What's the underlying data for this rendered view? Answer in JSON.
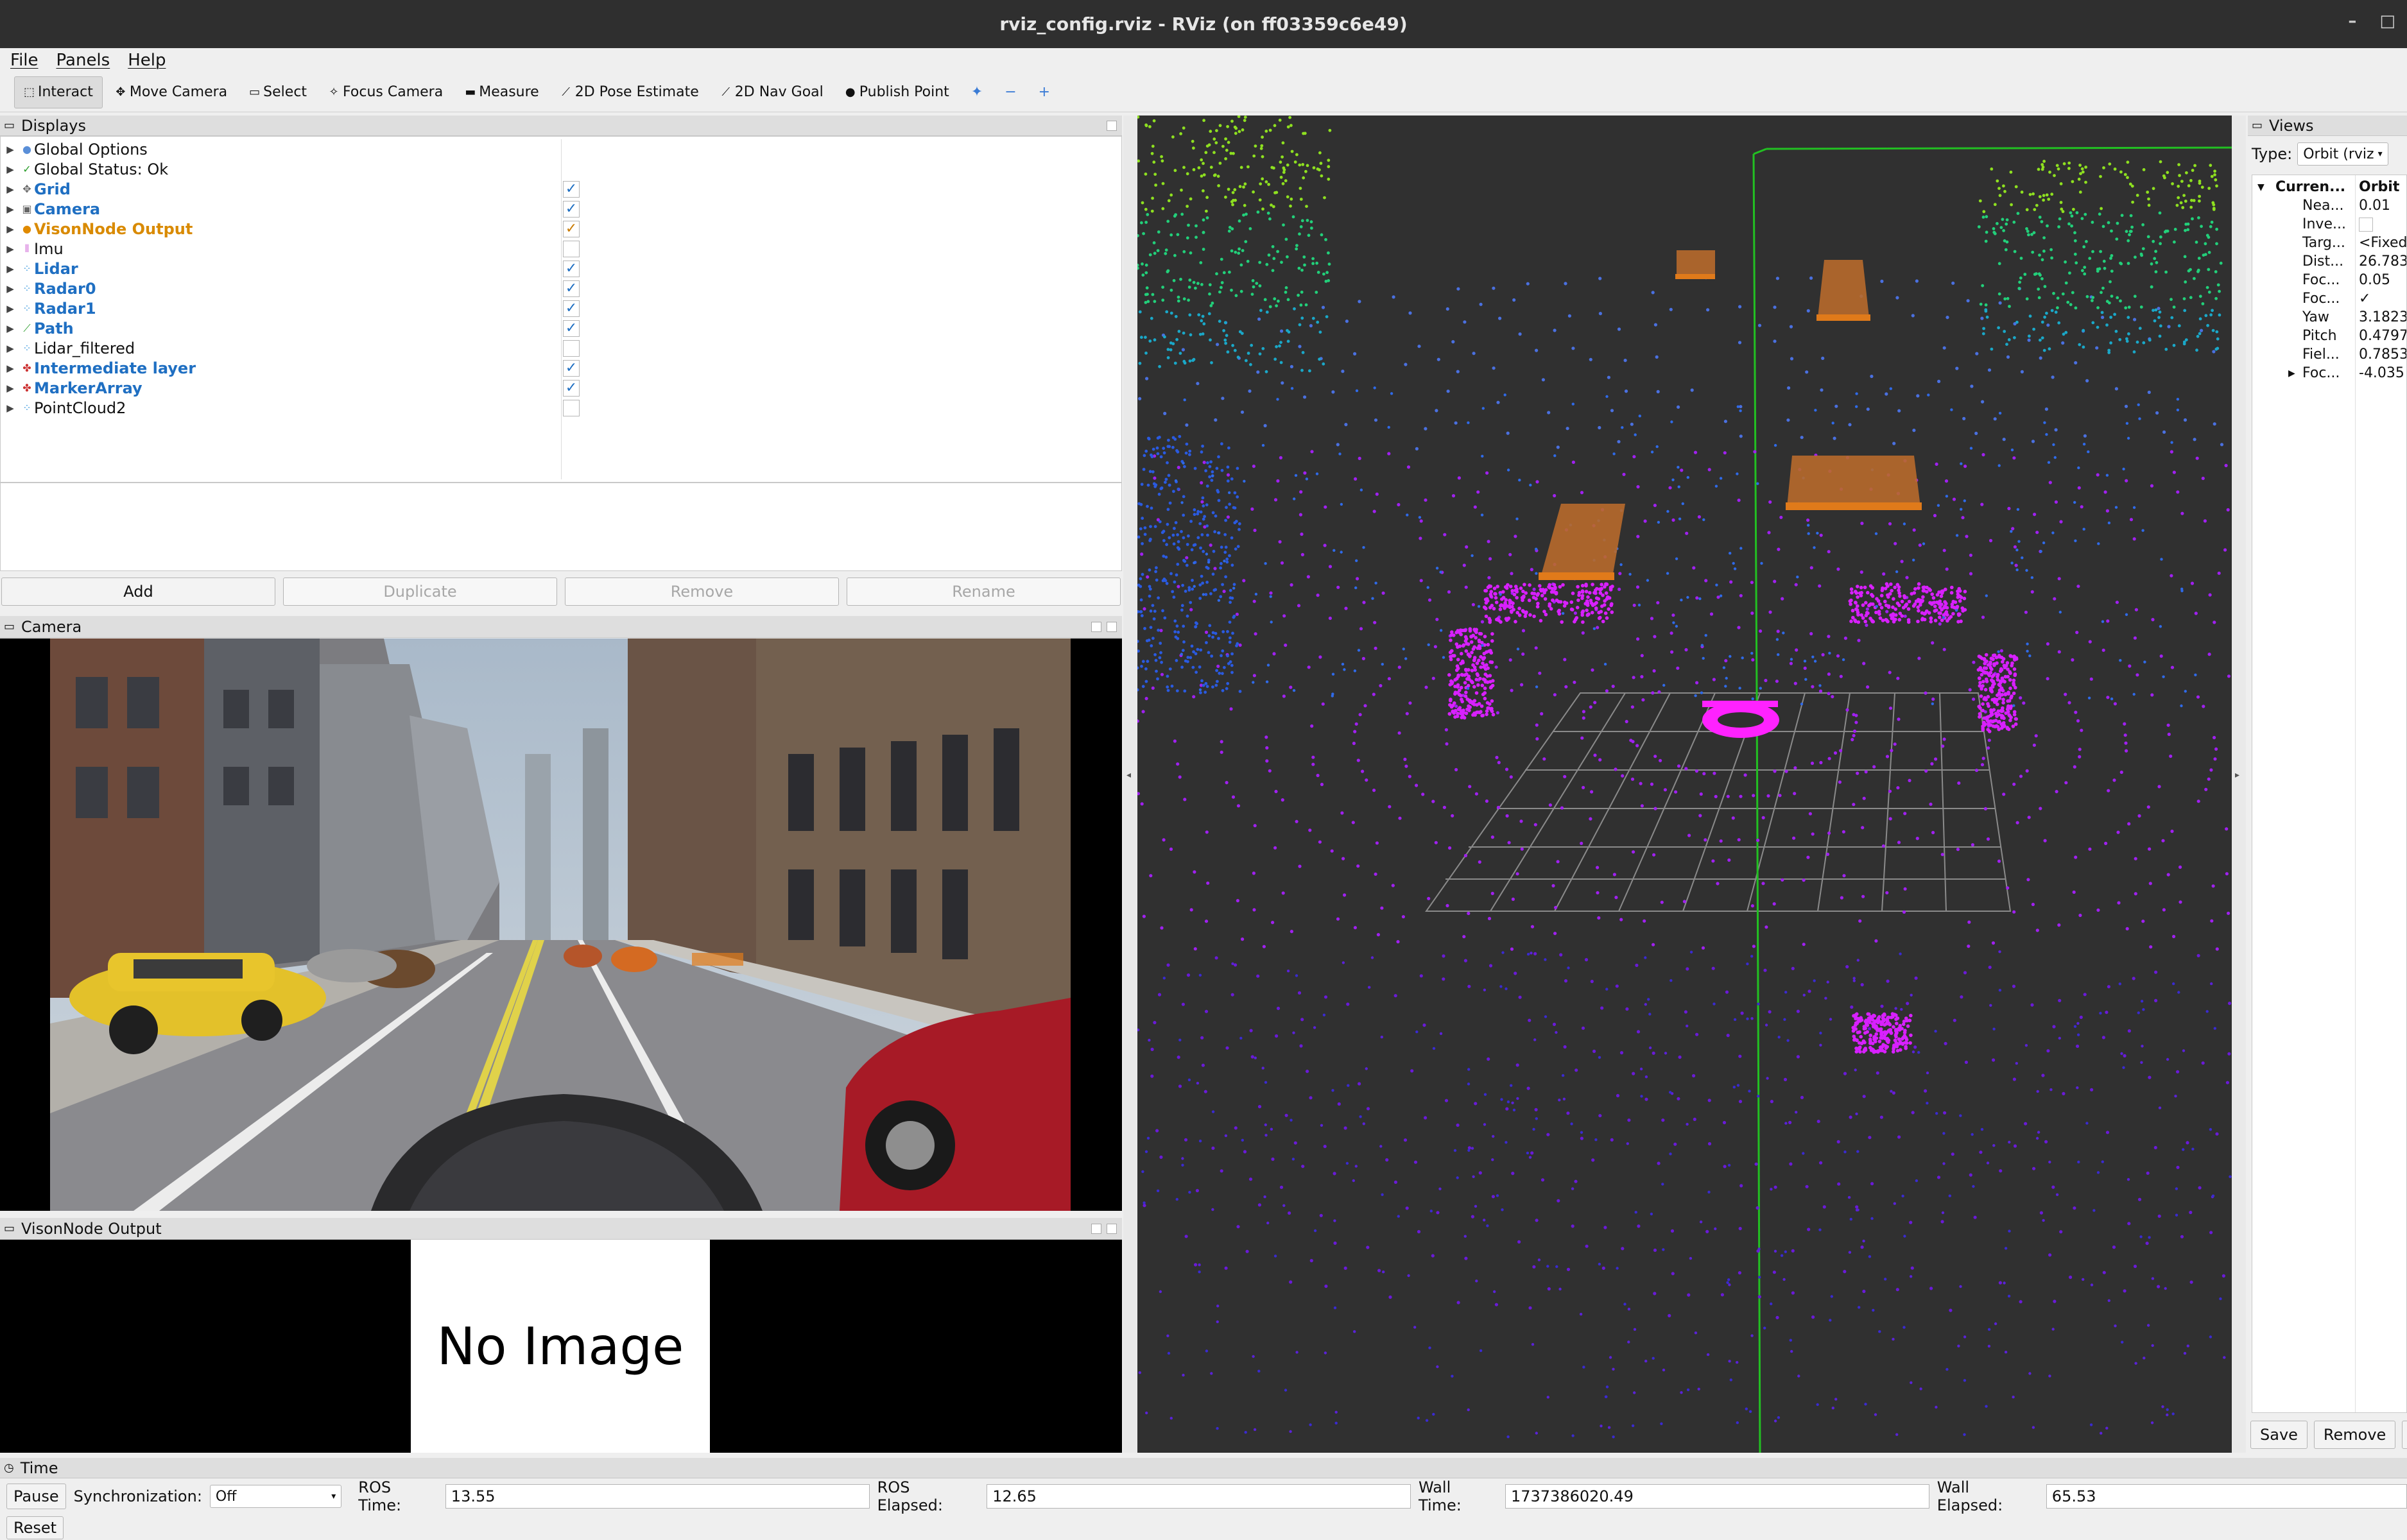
{
  "window": {
    "title": "rviz_config.rviz - RViz (on ff03359c6e49)",
    "controls": [
      "–",
      "□"
    ]
  },
  "menu": [
    "File",
    "Panels",
    "Help"
  ],
  "toolbar": {
    "tools": [
      {
        "label": "Interact",
        "icon": "interact-icon",
        "glyph": "⬚",
        "active": true
      },
      {
        "label": "Move Camera",
        "icon": "move-camera-icon",
        "glyph": "✥"
      },
      {
        "label": "Select",
        "icon": "select-icon",
        "glyph": "▭"
      },
      {
        "label": "Focus Camera",
        "icon": "focus-camera-icon",
        "glyph": "✧"
      },
      {
        "label": "Measure",
        "icon": "measure-icon",
        "glyph": "▬"
      },
      {
        "label": "2D Pose Estimate",
        "icon": "pose-estimate-icon",
        "glyph": "⟋"
      },
      {
        "label": "2D Nav Goal",
        "icon": "nav-goal-icon",
        "glyph": "⟋"
      },
      {
        "label": "Publish Point",
        "icon": "publish-point-icon",
        "glyph": "●"
      }
    ],
    "extra": [
      "✦",
      "−",
      "+"
    ]
  },
  "displays": {
    "title": "Displays",
    "items": [
      {
        "label": "Global Options",
        "icon": "●",
        "color": "#5a8fd8",
        "style": "normal",
        "checked": null
      },
      {
        "label": "Global Status: Ok",
        "icon": "✓",
        "color": "#2a9d2a",
        "style": "normal",
        "checked": null
      },
      {
        "label": "Grid",
        "icon": "✥",
        "color": "#666666",
        "style": "enabled",
        "checked": true
      },
      {
        "label": "Camera",
        "icon": "▣",
        "color": "#666666",
        "style": "enabled",
        "checked": true
      },
      {
        "label": "VisonNode Output",
        "icon": "●",
        "color": "#e08a00",
        "style": "warn",
        "checked": true
      },
      {
        "label": "Imu",
        "icon": "⦀",
        "color": "#d06ad8",
        "style": "normal",
        "checked": false
      },
      {
        "label": "Lidar",
        "icon": "⁘",
        "color": "#4aa0e0",
        "style": "enabled",
        "checked": true
      },
      {
        "label": "Radar0",
        "icon": "⁘",
        "color": "#4aa0e0",
        "style": "enabled",
        "checked": true
      },
      {
        "label": "Radar1",
        "icon": "⁘",
        "color": "#4aa0e0",
        "style": "enabled",
        "checked": true
      },
      {
        "label": "Path",
        "icon": "⟋",
        "color": "#2a9d2a",
        "style": "enabled",
        "checked": true
      },
      {
        "label": "Lidar_filtered",
        "icon": "⁘",
        "color": "#4aa0e0",
        "style": "normal",
        "checked": false
      },
      {
        "label": "Intermediate layer",
        "icon": "✤",
        "color": "#cc3333",
        "style": "enabled",
        "checked": true
      },
      {
        "label": "MarkerArray",
        "icon": "✤",
        "color": "#cc3333",
        "style": "enabled",
        "checked": true
      },
      {
        "label": "PointCloud2",
        "icon": "⁘",
        "color": "#4aa0e0",
        "style": "normal",
        "checked": false
      }
    ],
    "buttons": {
      "add": "Add",
      "duplicate": "Duplicate",
      "remove": "Remove",
      "rename": "Rename"
    }
  },
  "camera_panel": {
    "title": "Camera"
  },
  "vision_panel": {
    "title": "VisonNode Output",
    "placeholder": "No Image"
  },
  "views": {
    "title": "Views",
    "type_label": "Type:",
    "type_value": "Orbit (rviz",
    "header_key": "Curren...",
    "header_value": "Orbit",
    "rows": [
      {
        "k": "Nea...",
        "v": "0.01"
      },
      {
        "k": "Inve...",
        "v": ""
      },
      {
        "k": "Targ...",
        "v": "<Fixed"
      },
      {
        "k": "Dist...",
        "v": "26.783"
      },
      {
        "k": "Foc...",
        "v": "0.05"
      },
      {
        "k": "Foc...",
        "v": "✓"
      },
      {
        "k": "Yaw",
        "v": "3.1823"
      },
      {
        "k": "Pitch",
        "v": "0.4797"
      },
      {
        "k": "Fiel...",
        "v": "0.7853"
      },
      {
        "k": "Foc...",
        "v": "-4.035"
      }
    ],
    "buttons": {
      "save": "Save",
      "remove": "Remove",
      "rename": "R"
    }
  },
  "time": {
    "title": "Time",
    "pause": "Pause",
    "sync_label": "Synchronization:",
    "sync_value": "Off",
    "ros_time_label": "ROS Time:",
    "ros_time": "13.55",
    "ros_elapsed_label": "ROS Elapsed:",
    "ros_elapsed": "12.65",
    "wall_time_label": "Wall Time:",
    "wall_time": "1737386020.49",
    "wall_elapsed_label": "Wall Elapsed:",
    "wall_elapsed": "65.53",
    "reset": "Reset"
  }
}
